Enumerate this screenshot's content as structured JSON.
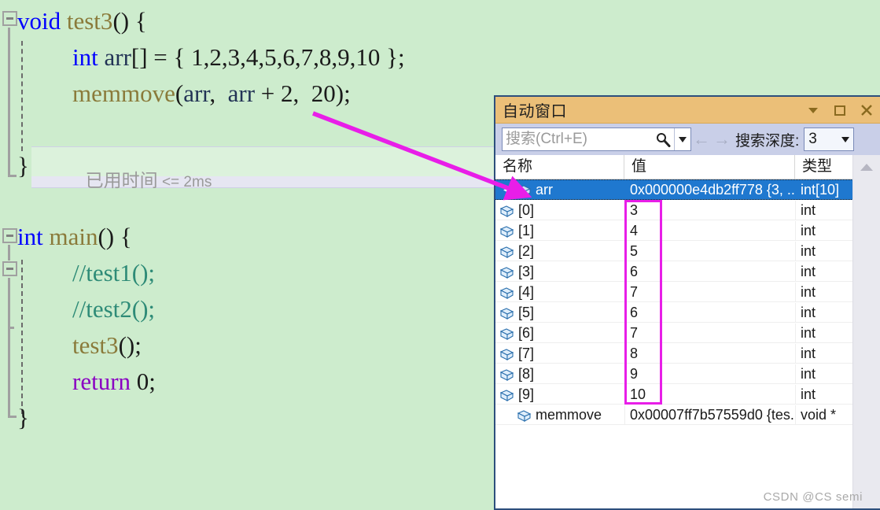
{
  "colors": {
    "editor_bg": "#cdeccd",
    "titlebar": "#ebbf78",
    "toolbar": "#c9cfe8",
    "selection": "#1f78cf",
    "annotation": "#e81ee8",
    "window_border": "#2d4f7c",
    "keyword": "#0000ff",
    "function": "#8a7a3a",
    "comment": "#2e8b77",
    "control_keyword": "#8a00c2"
  },
  "editor": {
    "lines": [
      {
        "indent": 0,
        "tokens": [
          {
            "text": "void",
            "cls": "kw"
          },
          {
            "text": " ",
            "cls": "plain"
          },
          {
            "text": "test3",
            "cls": "fn"
          },
          {
            "text": "() {",
            "cls": "plain"
          }
        ]
      },
      {
        "indent": 1,
        "tokens": [
          {
            "text": "int",
            "cls": "kw"
          },
          {
            "text": " ",
            "cls": "plain"
          },
          {
            "text": "arr",
            "cls": "ident"
          },
          {
            "text": "[] = { 1,2,3,4,5,6,7,8,9,10 };",
            "cls": "plain"
          }
        ]
      },
      {
        "indent": 1,
        "tokens": [
          {
            "text": "memmove",
            "cls": "fn"
          },
          {
            "text": "(",
            "cls": "plain"
          },
          {
            "text": "arr",
            "cls": "ident"
          },
          {
            "text": ",  ",
            "cls": "plain"
          },
          {
            "text": "arr",
            "cls": "ident"
          },
          {
            "text": " + 2,  20);",
            "cls": "plain"
          }
        ]
      },
      {
        "indent": 0,
        "tokens": [
          {
            "text": "}",
            "cls": "plain"
          }
        ]
      },
      {
        "indent": 0,
        "tokens": [
          {
            "text": "int",
            "cls": "kw"
          },
          {
            "text": " ",
            "cls": "plain"
          },
          {
            "text": "main",
            "cls": "fn"
          },
          {
            "text": "() {",
            "cls": "plain"
          }
        ]
      },
      {
        "indent": 1,
        "tokens": [
          {
            "text": "//test1();",
            "cls": "cmt"
          }
        ]
      },
      {
        "indent": 1,
        "tokens": [
          {
            "text": "//test2();",
            "cls": "cmt"
          }
        ]
      },
      {
        "indent": 1,
        "tokens": [
          {
            "text": "test3",
            "cls": "fn"
          },
          {
            "text": "();",
            "cls": "plain"
          }
        ]
      },
      {
        "indent": 1,
        "tokens": [
          {
            "text": "return",
            "cls": "kw2"
          },
          {
            "text": " 0;",
            "cls": "plain"
          }
        ]
      },
      {
        "indent": 0,
        "tokens": [
          {
            "text": "}",
            "cls": "plain"
          }
        ]
      }
    ],
    "elapsed_cjk": "已用时间",
    "elapsed_latin": " <= 2ms"
  },
  "autos_window": {
    "title": "自动窗口",
    "window_buttons": [
      {
        "name": "window-dropdown-icon",
        "glyph": "▼"
      },
      {
        "name": "float-window-icon",
        "glyph": "❐"
      },
      {
        "name": "close-icon",
        "glyph": "✕"
      }
    ],
    "search": {
      "placeholder": "搜索(Ctrl+E)",
      "value": "",
      "icon": "search-icon",
      "dropdown_glyph": "▾"
    },
    "nav": {
      "back_glyph": "←",
      "forward_glyph": "→"
    },
    "depth": {
      "label": "搜索深度:",
      "value": "3",
      "caret_glyph": "▾"
    },
    "grid": {
      "columns": [
        "名称",
        "值",
        "类型"
      ],
      "rows": [
        {
          "name": "arr",
          "value": "0x000000e4db2ff778 {3, ...",
          "type": "int[10]",
          "level": 0,
          "expanded": true,
          "selected": true
        },
        {
          "name": "[0]",
          "value": "3",
          "type": "int",
          "level": 1,
          "selected": false
        },
        {
          "name": "[1]",
          "value": "4",
          "type": "int",
          "level": 1,
          "selected": false
        },
        {
          "name": "[2]",
          "value": "5",
          "type": "int",
          "level": 1,
          "selected": false
        },
        {
          "name": "[3]",
          "value": "6",
          "type": "int",
          "level": 1,
          "selected": false
        },
        {
          "name": "[4]",
          "value": "7",
          "type": "int",
          "level": 1,
          "selected": false
        },
        {
          "name": "[5]",
          "value": "6",
          "type": "int",
          "level": 1,
          "selected": false
        },
        {
          "name": "[6]",
          "value": "7",
          "type": "int",
          "level": 1,
          "selected": false
        },
        {
          "name": "[7]",
          "value": "8",
          "type": "int",
          "level": 1,
          "selected": false
        },
        {
          "name": "[8]",
          "value": "9",
          "type": "int",
          "level": 1,
          "selected": false
        },
        {
          "name": "[9]",
          "value": "10",
          "type": "int",
          "level": 1,
          "selected": false
        },
        {
          "name": "memmove",
          "value": "0x00007ff7b57559d0 {tes...",
          "type": "void *",
          "level": 0,
          "selected": false
        }
      ]
    },
    "scrollbar": {
      "up_glyph": "▲"
    }
  },
  "watermark": "CSDN @CS semi"
}
